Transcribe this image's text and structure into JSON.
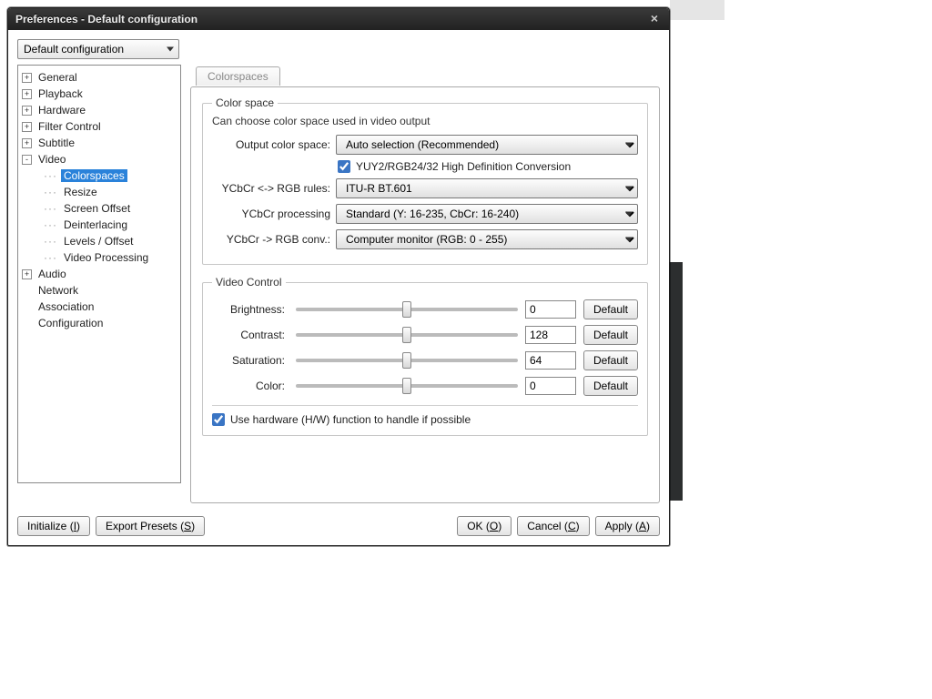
{
  "window": {
    "title": "Preferences - Default configuration"
  },
  "preset": {
    "value": "Default configuration"
  },
  "tree": {
    "items": [
      {
        "label": "General",
        "toggle": "+",
        "children": []
      },
      {
        "label": "Playback",
        "toggle": "+",
        "children": []
      },
      {
        "label": "Hardware",
        "toggle": "+",
        "children": []
      },
      {
        "label": "Filter Control",
        "toggle": "+",
        "children": []
      },
      {
        "label": "Subtitle",
        "toggle": "+",
        "children": []
      },
      {
        "label": "Video",
        "toggle": "-",
        "children": [
          {
            "label": "Colorspaces",
            "selected": true
          },
          {
            "label": "Resize"
          },
          {
            "label": "Screen Offset"
          },
          {
            "label": "Deinterlacing"
          },
          {
            "label": "Levels / Offset"
          },
          {
            "label": "Video Processing"
          }
        ]
      },
      {
        "label": "Audio",
        "toggle": "+",
        "children": []
      },
      {
        "label": "Network",
        "toggle": "",
        "children": []
      },
      {
        "label": "Association",
        "toggle": "",
        "children": []
      },
      {
        "label": "Configuration",
        "toggle": "",
        "children": []
      }
    ]
  },
  "tab": {
    "label": "Colorspaces"
  },
  "colorspace": {
    "legend": "Color space",
    "hint": "Can choose color space used in video output",
    "output_label": "Output color space:",
    "output_value": "Auto selection (Recommended)",
    "yuy2_label": "YUY2/RGB24/32 High Definition Conversion",
    "yuy2_checked": true,
    "rules_label": "YCbCr <-> RGB rules:",
    "rules_value": "ITU-R BT.601",
    "processing_label": "YCbCr processing",
    "processing_value": "Standard (Y: 16-235, CbCr: 16-240)",
    "conv_label": "YCbCr -> RGB conv.:",
    "conv_value": "Computer monitor (RGB: 0 - 255)"
  },
  "video_control": {
    "legend": "Video Control",
    "rows": [
      {
        "label": "Brightness:",
        "value": "0",
        "min": -128,
        "max": 128,
        "pos": 0,
        "default": "Default"
      },
      {
        "label": "Contrast:",
        "value": "128",
        "min": 0,
        "max": 255,
        "pos": 128,
        "default": "Default"
      },
      {
        "label": "Saturation:",
        "value": "64",
        "min": 0,
        "max": 128,
        "pos": 64,
        "default": "Default"
      },
      {
        "label": "Color:",
        "value": "0",
        "min": -128,
        "max": 128,
        "pos": 0,
        "default": "Default"
      }
    ],
    "hw_label": "Use hardware (H/W) function to handle if possible",
    "hw_checked": true
  },
  "buttons": {
    "initialize": "Initialize",
    "initialize_key": "I",
    "export": "Export Presets",
    "export_key": "S",
    "ok": "OK",
    "ok_key": "O",
    "cancel": "Cancel",
    "cancel_key": "C",
    "apply": "Apply",
    "apply_key": "A"
  }
}
